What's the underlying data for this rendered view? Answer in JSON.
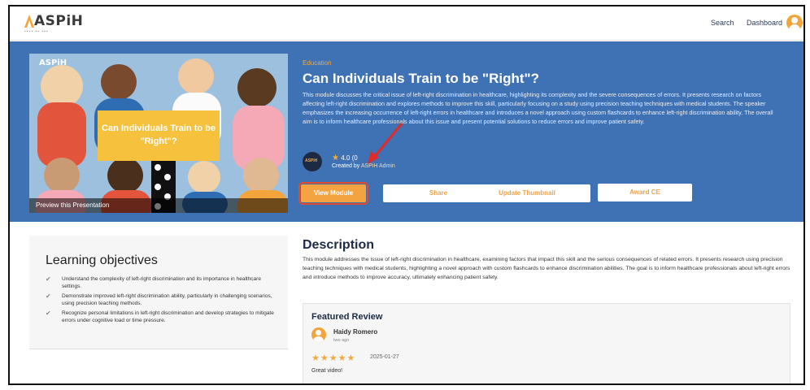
{
  "header": {
    "logo_text": "ASPiH",
    "nav": {
      "search": "Search",
      "dashboard": "Dashboard"
    }
  },
  "hero": {
    "thumbnail": {
      "logo": "ASPiH",
      "card_title": "Can Individuals Train to be \"Right\"?",
      "caption": "Preview this Presentation"
    },
    "category": "Education",
    "title": "Can Individuals Train to be \"Right\"?",
    "summary": "This module discusses the critical issue of left-right discrimination in healthcare, highlighting its complexity and the severe consequences of errors. It presents research on factors affecting left-right discrimination and explores methods to improve this skill, particularly focusing on a study using precision teaching techniques with medical students. The speaker emphasizes the increasing occurrence of left-right errors in healthcare and introduces a novel approach using custom flashcards to enhance left-right discrimination ability. The overall aim is to inform healthcare professionals about this issue and present potential solutions to reduce errors and improve patient safety.",
    "rating_value": "4.0",
    "rating_count": "(0",
    "created_prefix": "Created by",
    "author": "ASPiH Admin",
    "buttons": {
      "view": "View Module",
      "share": "Share",
      "thumbnail": "Update Thumbnail",
      "award": "Award CE"
    }
  },
  "learning": {
    "title": "Learning objectives",
    "items": [
      "Understand the complexity of left-right discrimination and its importance in healthcare settings.",
      "Demonstrate improved left-right discrimination ability, particularly in challenging scenarios, using precision teaching methods.",
      "Recognize personal limitations in left-right discrimination and develop strategies to mitigate errors under cognitive load or time pressure."
    ]
  },
  "description": {
    "title": "Description",
    "text": "This module addresses the issue of left-right discrimination in healthcare, examining factors that impact this skill and the serious consequences of related errors. It presents research using precision teaching techniques with medical students, highlighting a novel approach with custom flashcards to enhance discrimination abilities. The goal is to inform healthcare professionals about left-right errors and introduce methods to improve accuracy, ultimately enhancing patient safety."
  },
  "review": {
    "title": "Featured Review",
    "name": "Haidy Romero",
    "ago": "two ago",
    "stars": "★★★★★",
    "date": "2025-01-27",
    "text": "Great video!"
  },
  "colors": {
    "hero_bg": "#3e72b4",
    "accent": "#f3a340",
    "highlight": "#e14b2b"
  }
}
